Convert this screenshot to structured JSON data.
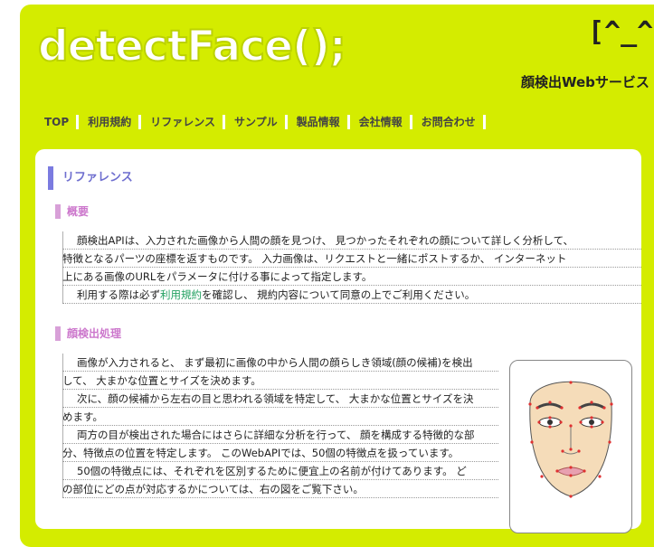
{
  "header": {
    "logo_text": "detectFace();",
    "face_mark": "[^_^]",
    "service_name": "顔検出Webサービス"
  },
  "nav": {
    "items": [
      "TOP",
      "利用規約",
      "リファレンス",
      "サンプル",
      "製品情報",
      "会社情報",
      "お問合わせ"
    ]
  },
  "page": {
    "title": "リファレンス",
    "overview": {
      "heading": "概要",
      "lines": [
        "顔検出APIは、入力された画像から人間の顔を見つけ、 見つかったそれぞれの顔について詳しく分析して、",
        "特徴となるパーツの座標を返すものです。 入力画像は、リクエストと一緒にポストするか、 インターネット",
        "上にある画像のURLをパラメータに付ける事によって指定します。"
      ],
      "terms_before": "利用する際は必ず",
      "terms_link": "利用規約",
      "terms_after": "を確認し、 規約内容について同意の上でご利用ください。"
    },
    "processing": {
      "heading": "顔検出処理",
      "lines": [
        "画像が入力されると、 まず最初に画像の中から人間の顔らしき領域(顔の候補)を検出",
        "して、 大まかな位置とサイズを決めます。",
        "次に、顔の候補から左右の目と思われる領域を特定して、 大まかな位置とサイズを決",
        "めます。",
        "両方の目が検出された場合にはさらに詳細な分析を行って、 顔を構成する特徴的な部",
        "分、特徴点の位置を特定します。 このWebAPIでは、50個の特徴点を扱っています。",
        "50個の特徴点には、それぞれを区別するために便宜上の名前が付けてあります。 ど",
        "の部位にどの点が対応するかについては、右の図をご覧下さい。"
      ]
    }
  },
  "colors": {
    "frame": "#d4ec00",
    "title_bar": "#7b7be0",
    "section_bar": "#d8a0d8",
    "feature_point": "#e03030"
  }
}
